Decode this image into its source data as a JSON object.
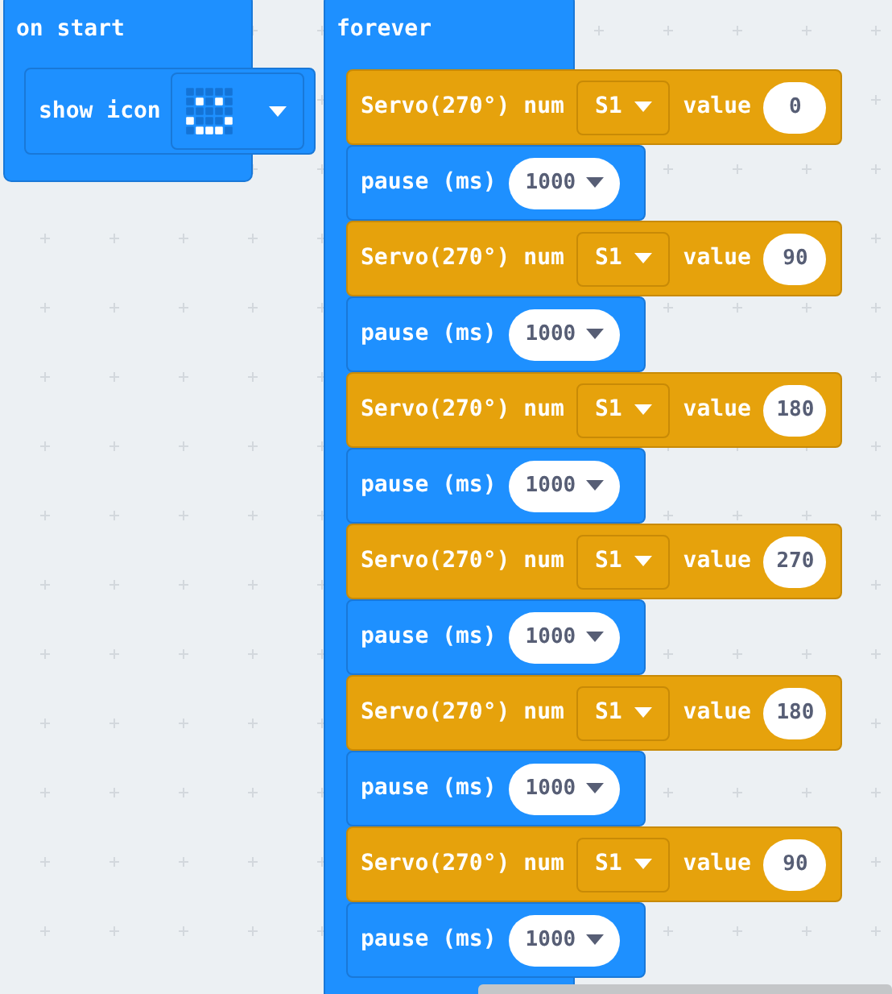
{
  "on_start": {
    "label": "on start",
    "blocks": [
      {
        "kind": "show_icon",
        "label": "show icon",
        "leds": [
          [
            false,
            false,
            false,
            false,
            false
          ],
          [
            false,
            true,
            false,
            true,
            false
          ],
          [
            false,
            false,
            false,
            false,
            false
          ],
          [
            true,
            false,
            false,
            false,
            true
          ],
          [
            false,
            true,
            true,
            true,
            false
          ]
        ]
      }
    ]
  },
  "forever": {
    "label": "forever",
    "blocks": [
      {
        "kind": "servo",
        "label": "Servo(270°) num",
        "pin": "S1",
        "value_label": "value",
        "value": "0"
      },
      {
        "kind": "pause",
        "label": "pause (ms)",
        "value": "1000"
      },
      {
        "kind": "servo",
        "label": "Servo(270°) num",
        "pin": "S1",
        "value_label": "value",
        "value": "90"
      },
      {
        "kind": "pause",
        "label": "pause (ms)",
        "value": "1000"
      },
      {
        "kind": "servo",
        "label": "Servo(270°) num",
        "pin": "S1",
        "value_label": "value",
        "value": "180"
      },
      {
        "kind": "pause",
        "label": "pause (ms)",
        "value": "1000"
      },
      {
        "kind": "servo",
        "label": "Servo(270°) num",
        "pin": "S1",
        "value_label": "value",
        "value": "270"
      },
      {
        "kind": "pause",
        "label": "pause (ms)",
        "value": "1000"
      },
      {
        "kind": "servo",
        "label": "Servo(270°) num",
        "pin": "S1",
        "value_label": "value",
        "value": "180"
      },
      {
        "kind": "pause",
        "label": "pause (ms)",
        "value": "1000"
      },
      {
        "kind": "servo",
        "label": "Servo(270°) num",
        "pin": "S1",
        "value_label": "value",
        "value": "90"
      },
      {
        "kind": "pause",
        "label": "pause (ms)",
        "value": "1000"
      }
    ]
  }
}
